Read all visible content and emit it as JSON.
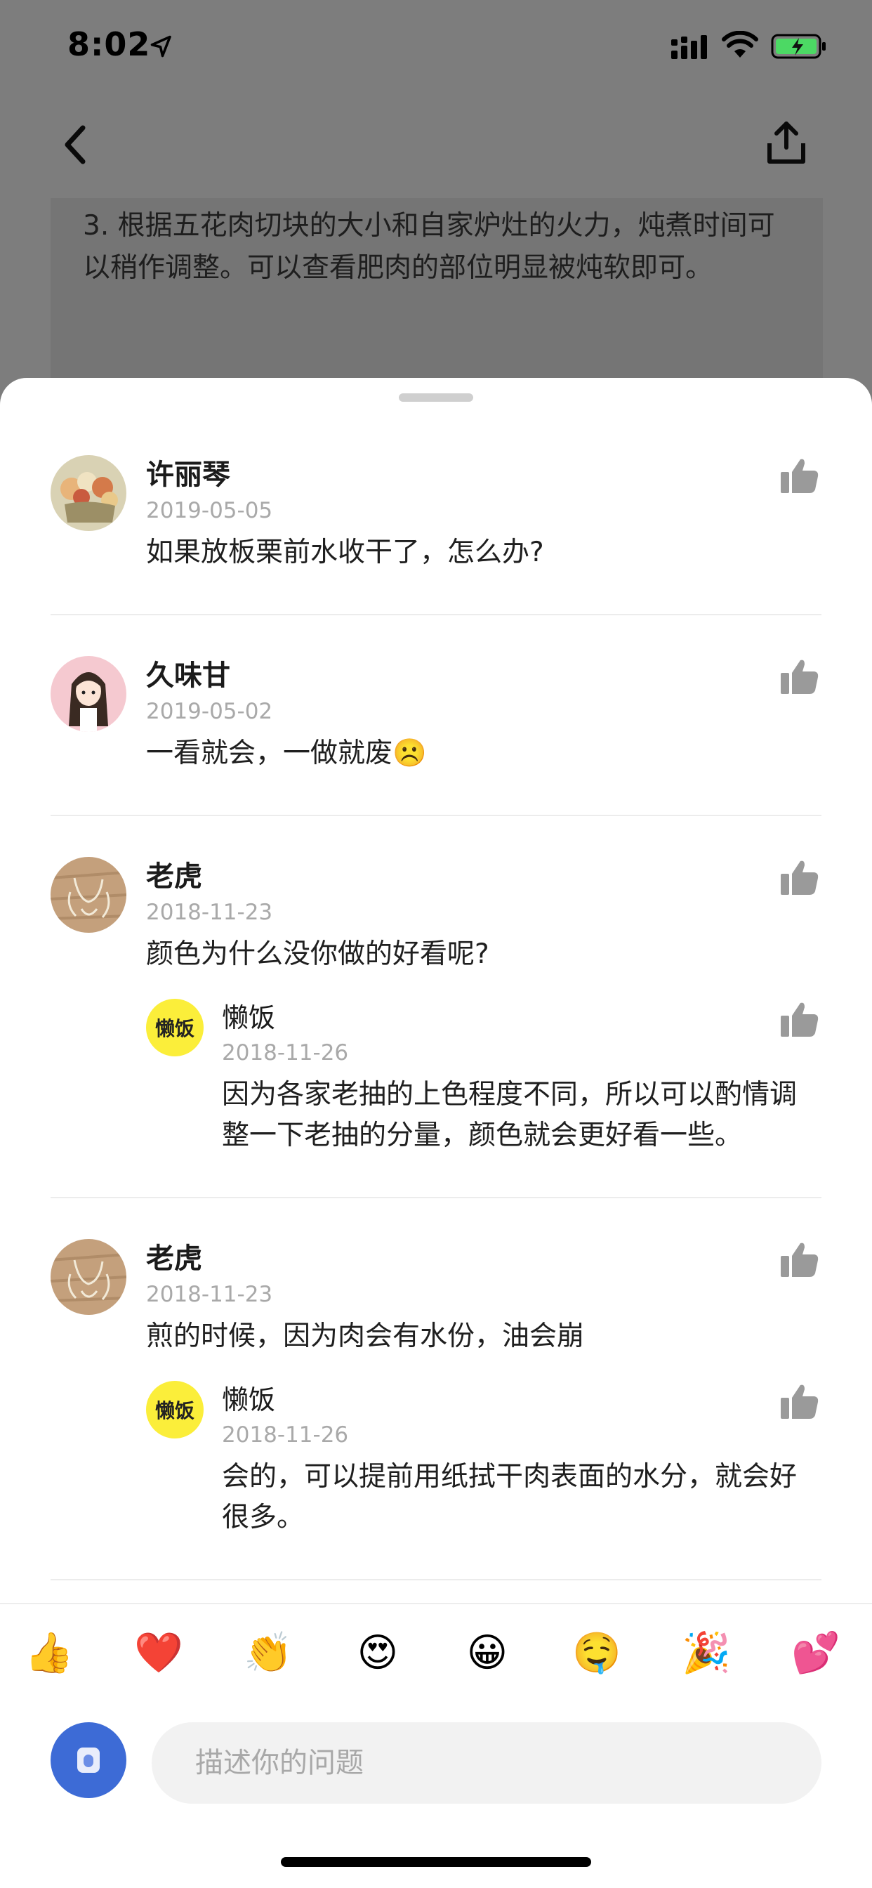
{
  "status_bar": {
    "time": "8:02"
  },
  "background": {
    "step_text": "3. 根据五花肉切块的大小和自家炉灶的火力，炖煮时间可以稍作调整。可以查看肥肉的部位明显被炖软即可。"
  },
  "comments": [
    {
      "name": "许丽琴",
      "date": "2019-05-05",
      "text": "如果放板栗前水收干了，怎么办?",
      "avatar": "flowers-avatar"
    },
    {
      "name": "久味甘",
      "date": "2019-05-02",
      "text": "一看就会，一做就废☹️",
      "avatar": "girl-avatar"
    },
    {
      "name": "老虎",
      "date": "2018-11-23",
      "text": "颜色为什么没你做的好看呢?",
      "avatar": "sketch-avatar",
      "reply": {
        "name": "懒饭",
        "date": "2018-11-26",
        "text": "因为各家老抽的上色程度不同，所以可以酌情调整一下老抽的分量，颜色就会更好看一些。",
        "badge": "懒饭"
      }
    },
    {
      "name": "老虎",
      "date": "2018-11-23",
      "text": "煎的时候，因为肉会有水份，油会崩",
      "avatar": "sketch-avatar",
      "reply": {
        "name": "懒饭",
        "date": "2018-11-26",
        "text": "会的，可以提前用纸拭干肉表面的水分，就会好很多。",
        "badge": "懒饭"
      }
    }
  ],
  "emojis": [
    "👍",
    "❤️",
    "👏",
    "😍",
    "😀",
    "🤤",
    "🎉",
    "💕"
  ],
  "composer": {
    "placeholder": "描述你的问题"
  },
  "colors": {
    "accent": "#3d6bd6",
    "badge_yellow": "#fbee3a",
    "sheet": "#ffffff",
    "overlay": "#7d7d7d"
  }
}
